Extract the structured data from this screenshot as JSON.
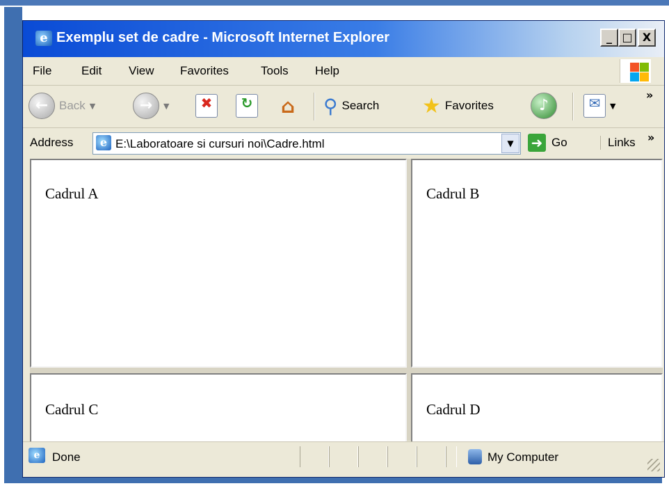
{
  "window": {
    "title": "Exemplu set de cadre - Microsoft Internet Explorer",
    "min_label": "_",
    "max_label": "□",
    "close_label": "X"
  },
  "menu": {
    "items": [
      "File",
      "Edit",
      "View",
      "Favorites",
      "Tools",
      "Help"
    ]
  },
  "toolbar": {
    "back_label": "Back",
    "search_label": "Search",
    "favorites_label": "Favorites",
    "more_label": "»"
  },
  "address": {
    "label": "Address",
    "value": "E:\\Laboratoare si cursuri noi\\Cadre.html",
    "go_label": "Go",
    "links_label": "Links",
    "links_more": "»"
  },
  "frames": {
    "a": "Cadrul A",
    "b": "Cadrul B",
    "c": "Cadrul C",
    "d": "Cadrul D"
  },
  "status": {
    "text": "Done",
    "zone": "My Computer"
  },
  "colors": {
    "title_gradient_start": "#0a4bd6",
    "chrome": "#ece9d8",
    "desktop_blue": "#3f6fb0"
  },
  "icons": [
    "ie-logo-icon",
    "back-icon",
    "forward-icon",
    "stop-icon",
    "refresh-icon",
    "home-icon",
    "search-icon",
    "favorites-star-icon",
    "media-icon",
    "mail-icon",
    "windows-flag-icon",
    "go-arrow-icon",
    "my-computer-icon",
    "resize-grip-icon"
  ]
}
